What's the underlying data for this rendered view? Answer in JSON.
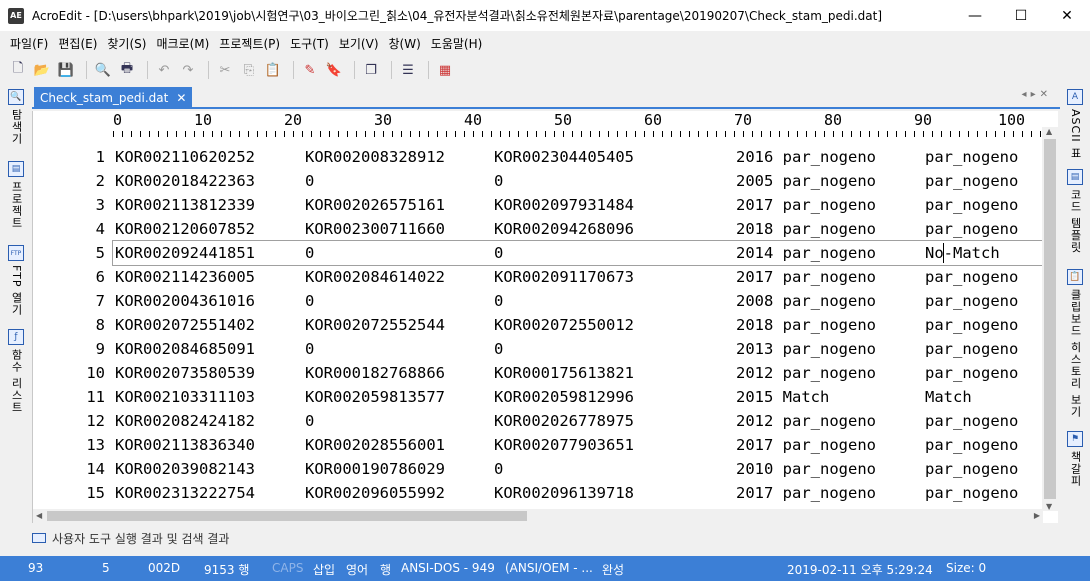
{
  "window": {
    "app_icon": "AE",
    "title": "AcroEdit - [D:\\users\\bhpark\\2019\\job\\시험연구\\03_바이오그린_칡소\\04_유전자분석결과\\칡소유전체원본자료\\parentage\\20190207\\Check_stam_pedi.dat]",
    "controls": {
      "minimize": "—",
      "maximize": "☐",
      "close": "✕"
    }
  },
  "menu": [
    "파일(F)",
    "편집(E)",
    "찾기(S)",
    "매크로(M)",
    "프로젝트(P)",
    "도구(T)",
    "보기(V)",
    "창(W)",
    "도움말(H)"
  ],
  "toolbar": {
    "icons": [
      "new-file-icon",
      "open-folder-icon",
      "save-icon",
      "print-preview-icon",
      "print-icon",
      "undo-icon",
      "redo-icon",
      "cut-icon",
      "copy-icon",
      "paste-icon",
      "marker-icon",
      "bookmark-icon",
      "window-icon",
      "list-icon",
      "grid-icon"
    ]
  },
  "left_panel": {
    "tabs": [
      "탐색기",
      "프로젝트",
      "FTP 열기",
      "함수 리스트"
    ]
  },
  "right_panel": {
    "tabs": [
      "ASCII 표",
      "코드 템플릿",
      "클립보드 히스토리 보기",
      "책갈피"
    ]
  },
  "editor": {
    "tab_label": "Check_stam_pedi.dat",
    "ruler": [
      "0",
      "10",
      "20",
      "30",
      "40",
      "50",
      "60",
      "70",
      "80",
      "90",
      "100"
    ],
    "current_line": 5,
    "lines": [
      {
        "n": "1",
        "c": [
          "KOR002110620252",
          "KOR002008328912",
          "KOR002304405405",
          "2016 par_nogeno",
          "par_nogeno"
        ]
      },
      {
        "n": "2",
        "c": [
          "KOR002018422363",
          "0",
          "0",
          "2005 par_nogeno",
          "par_nogeno"
        ]
      },
      {
        "n": "3",
        "c": [
          "KOR002113812339",
          "KOR002026575161",
          "KOR002097931484",
          "2017 par_nogeno",
          "par_nogeno"
        ]
      },
      {
        "n": "4",
        "c": [
          "KOR002120607852",
          "KOR002300711660",
          "KOR002094268096",
          "2018 par_nogeno",
          "par_nogeno"
        ]
      },
      {
        "n": "5",
        "c": [
          "KOR002092441851",
          "0",
          "0",
          "2014 par_nogeno",
          "No-Match"
        ]
      },
      {
        "n": "6",
        "c": [
          "KOR002114236005",
          "KOR002084614022",
          "KOR002091170673",
          "2017 par_nogeno",
          "par_nogeno"
        ]
      },
      {
        "n": "7",
        "c": [
          "KOR002004361016",
          "0",
          "0",
          "2008 par_nogeno",
          "par_nogeno"
        ]
      },
      {
        "n": "8",
        "c": [
          "KOR002072551402",
          "KOR002072552544",
          "KOR002072550012",
          "2018 par_nogeno",
          "par_nogeno"
        ]
      },
      {
        "n": "9",
        "c": [
          "KOR002084685091",
          "0",
          "0",
          "2013 par_nogeno",
          "par_nogeno"
        ]
      },
      {
        "n": "10",
        "c": [
          "KOR002073580539",
          "KOR000182768866",
          "KOR000175613821",
          "2012 par_nogeno",
          "par_nogeno"
        ]
      },
      {
        "n": "11",
        "c": [
          "KOR002103311103",
          "KOR002059813577",
          "KOR002059812996",
          "2015 Match",
          "Match"
        ]
      },
      {
        "n": "12",
        "c": [
          "KOR002082424182",
          "0",
          "KOR002026778975",
          "2012 par_nogeno",
          "par_nogeno"
        ]
      },
      {
        "n": "13",
        "c": [
          "KOR002113836340",
          "KOR002028556001",
          "KOR002077903651",
          "2017 par_nogeno",
          "par_nogeno"
        ]
      },
      {
        "n": "14",
        "c": [
          "KOR002039082143",
          "KOR000190786029",
          "0",
          "2010 par_nogeno",
          "par_nogeno"
        ]
      },
      {
        "n": "15",
        "c": [
          "KOR002313222754",
          "KOR002096055992",
          "KOR002096139718",
          "2017 par_nogeno",
          "par_nogeno"
        ]
      }
    ]
  },
  "output_panel": {
    "label": "사용자 도구 실행 결과 및 검색 결과"
  },
  "statusbar": {
    "col": "93",
    "line": "5",
    "hex": "002D",
    "total_lines": "9153 행",
    "caps": "CAPS",
    "insert": "삽입",
    "lang": "영어",
    "unit": "행",
    "encoding": "ANSI-DOS - 949",
    "encoding2": "(ANSI/OEM - ...",
    "complete": "완성",
    "datetime": "2019-02-11 오후 5:29:24",
    "size": "Size: 0"
  },
  "colors": {
    "accent": "#3c7fd6",
    "status_dim": "#8fb4e8"
  }
}
